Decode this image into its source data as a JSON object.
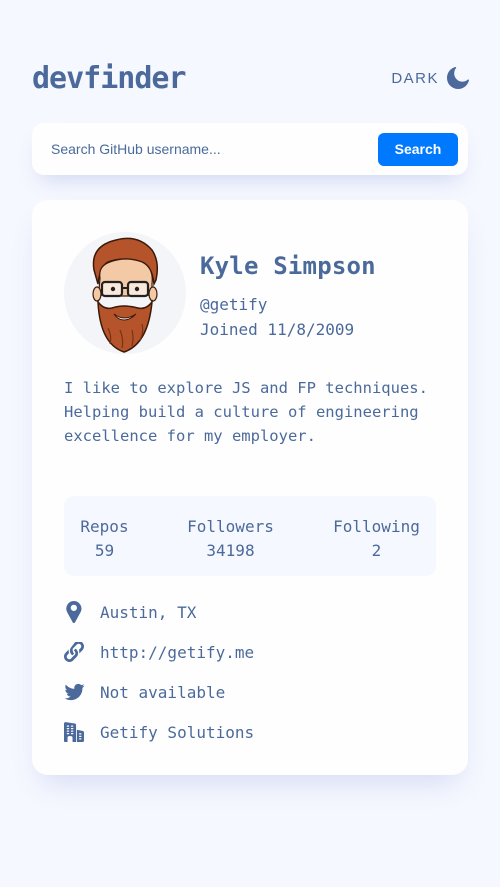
{
  "header": {
    "logo": "devfinder",
    "theme_label": "DARK",
    "theme_icon": "moon-icon"
  },
  "search": {
    "placeholder": "Search GitHub username...",
    "value": "",
    "button_label": "Search"
  },
  "profile": {
    "name": "Kyle Simpson",
    "login": "@getify",
    "joined": "Joined 11/8/2009",
    "bio": "I like to explore JS and FP techniques. Helping build a culture of engineering excellence for my employer.",
    "stats": [
      {
        "label": "Repos",
        "value": "59"
      },
      {
        "label": "Followers",
        "value": "34198"
      },
      {
        "label": "Following",
        "value": "2"
      }
    ],
    "links": {
      "location": {
        "icon": "location-pin-icon",
        "text": "Austin, TX"
      },
      "blog": {
        "icon": "link-icon",
        "text": "http://getify.me"
      },
      "twitter": {
        "icon": "twitter-icon",
        "text": "Not available"
      },
      "company": {
        "icon": "building-icon",
        "text": "Getify Solutions"
      }
    }
  },
  "colors": {
    "background": "#f6f8ff",
    "card": "#fefefe",
    "accent": "#0079ff",
    "text": "#4b6a9b"
  }
}
